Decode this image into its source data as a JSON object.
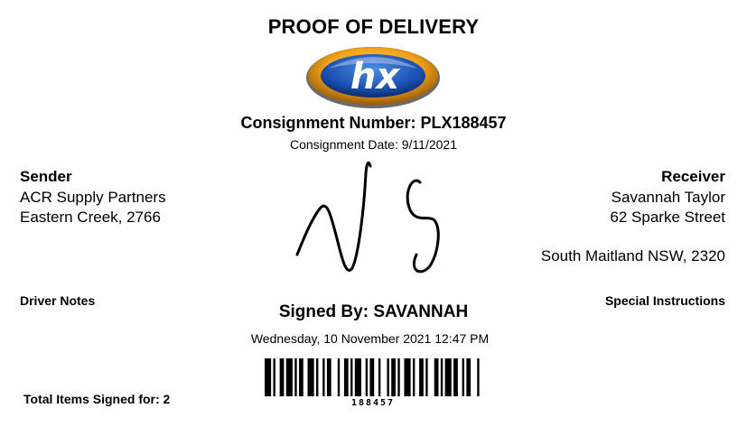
{
  "document": {
    "title": "PROOF OF DELIVERY",
    "logo_text": "hx",
    "consignment_number": "Consignment Number: PLX188457",
    "consignment_date": "Consignment Date: 9/11/2021"
  },
  "sender": {
    "label": "Sender",
    "name": "ACR Supply Partners",
    "address": "Eastern Creek, 2766"
  },
  "receiver": {
    "label": "Receiver",
    "name": "Savannah Taylor",
    "street": "62 Sparke Street",
    "city": "South Maitland NSW, 2320"
  },
  "notes": {
    "driver_notes_label": "Driver Notes",
    "special_instructions_label": "Special Instructions"
  },
  "signature": {
    "signed_by": "Signed By: SAVANNAH",
    "signed_datetime": "Wednesday, 10 November 2021 12:47 PM"
  },
  "footer": {
    "total_items": "Total Items Signed for: 2",
    "barcode_number": "188457"
  }
}
